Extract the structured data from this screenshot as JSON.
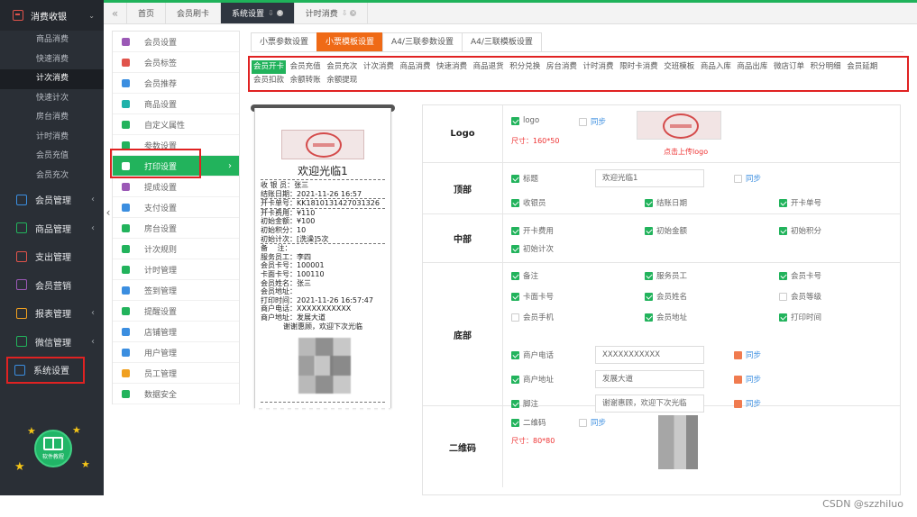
{
  "sidebar": {
    "top": {
      "label": "消费收银"
    },
    "sub_items": [
      "商品消费",
      "快速消费",
      "计次消费",
      "快速计次",
      "房台消费",
      "计时消费",
      "会员充值",
      "会员充次"
    ],
    "active_sub": 2,
    "groups": [
      {
        "label": "会员管理",
        "icon": "users-icon",
        "color": "#3b8ee0",
        "arrow": "‹"
      },
      {
        "label": "商品管理",
        "icon": "box-icon",
        "color": "#22b35c",
        "arrow": "‹"
      },
      {
        "label": "支出管理",
        "icon": "expense-icon",
        "color": "#e0534b",
        "arrow": ""
      },
      {
        "label": "会员营销",
        "icon": "gift-icon",
        "color": "#9b59b6",
        "arrow": ""
      },
      {
        "label": "报表管理",
        "icon": "chart-icon",
        "color": "#f0a020",
        "arrow": "‹"
      },
      {
        "label": "微信管理",
        "icon": "wechat-icon",
        "color": "#22b35c",
        "arrow": "‹"
      },
      {
        "label": "系统设置",
        "icon": "gear-icon",
        "color": "#3b8ee0",
        "arrow": ""
      }
    ],
    "help_label": "软件教程"
  },
  "tabs": [
    {
      "label": "首页",
      "active": false,
      "closable": false
    },
    {
      "label": "会员刷卡",
      "active": false,
      "closable": false
    },
    {
      "label": "系统设置",
      "active": true,
      "closable": true
    },
    {
      "label": "计时消费",
      "active": false,
      "closable": true
    }
  ],
  "settings_menu": [
    {
      "label": "会员设置",
      "color": "#9b59b6"
    },
    {
      "label": "会员标签",
      "color": "#e0534b"
    },
    {
      "label": "会员推荐",
      "color": "#3b8ee0"
    },
    {
      "label": "商品设置",
      "color": "#20b2aa"
    },
    {
      "label": "自定义属性",
      "color": "#22b35c"
    },
    {
      "label": "参数设置",
      "color": "#22b35c"
    },
    {
      "label": "打印设置",
      "color": "#ffffff",
      "active": true
    },
    {
      "label": "提成设置",
      "color": "#9b59b6"
    },
    {
      "label": "支付设置",
      "color": "#3b8ee0"
    },
    {
      "label": "房台设置",
      "color": "#22b35c"
    },
    {
      "label": "计次规则",
      "color": "#22b35c"
    },
    {
      "label": "计时管理",
      "color": "#22b35c"
    },
    {
      "label": "签到管理",
      "color": "#3b8ee0"
    },
    {
      "label": "提醒设置",
      "color": "#22b35c"
    },
    {
      "label": "店铺管理",
      "color": "#3b8ee0"
    },
    {
      "label": "用户管理",
      "color": "#3b8ee0"
    },
    {
      "label": "员工管理",
      "color": "#f0a020"
    },
    {
      "label": "数据安全",
      "color": "#22b35c"
    }
  ],
  "template_tabs": [
    {
      "label": "小票参数设置",
      "active": false
    },
    {
      "label": "小票模板设置",
      "active": true
    },
    {
      "label": "A4/三联参数设置",
      "active": false
    },
    {
      "label": "A4/三联模板设置",
      "active": false
    }
  ],
  "print_types": [
    "会员开卡",
    "会员充值",
    "会员充次",
    "计次消费",
    "商品消费",
    "快速消费",
    "商品退货",
    "积分兑换",
    "房台消费",
    "计时消费",
    "限时卡消费",
    "交班模板",
    "商品入库",
    "商品出库",
    "微店订单",
    "积分明细",
    "会员延期",
    "会员扣款",
    "余额转账",
    "余额提现"
  ],
  "active_type": 0,
  "receipt": {
    "title": "欢迎光临1",
    "lines_top": [
      "收 银 员：张三",
      "结账日期：2021-11-26 16:57"
    ],
    "lines_card": [
      "开卡单号：KK1810131427031326"
    ],
    "lines_mid": [
      "开卡费用：¥110",
      "初始金额：¥100",
      "初始积分：10"
    ],
    "lines_count": [
      "初始计次：[洗澡]5次"
    ],
    "lines_bottom": [
      "备　 注：",
      "服务员工：李四",
      "会员卡号：100001",
      "卡面卡号：100110",
      "会员姓名：张三",
      "会员地址：",
      "打印时间：2021-11-26 16:57:47",
      "商户电话：XXXXXXXXXXX",
      "商户地址：发展大道"
    ],
    "footer": "谢谢惠顾，欢迎下次光临"
  },
  "config": {
    "logo": {
      "label": "Logo",
      "checkbox": "logo",
      "sync": "同步",
      "size_hint": "尺寸：160*50",
      "upload_link": "点击上传logo"
    },
    "top": {
      "label": "顶部",
      "title_cb": "标题",
      "title_value": "欢迎光临1",
      "sync": "同步",
      "cashier": "收银员",
      "checkout_date": "结账日期",
      "card_no": "开卡单号"
    },
    "middle": {
      "label": "中部",
      "items": [
        "开卡费用",
        "初始金额",
        "初始积分",
        "初始计次"
      ]
    },
    "bottom": {
      "label": "底部",
      "items": [
        {
          "label": "备注",
          "on": true
        },
        {
          "label": "服务员工",
          "on": true
        },
        {
          "label": "会员卡号",
          "on": true
        },
        {
          "label": "卡面卡号",
          "on": true
        },
        {
          "label": "会员姓名",
          "on": true
        },
        {
          "label": "会员等级",
          "on": false
        },
        {
          "label": "会员手机",
          "on": false
        },
        {
          "label": "会员地址",
          "on": true
        },
        {
          "label": "打印时间",
          "on": true
        }
      ],
      "phone_label": "商户电话",
      "phone_value": "XXXXXXXXXXX",
      "address_label": "商户地址",
      "address_value": "发展大道",
      "footer_label": "脚注",
      "footer_value": "谢谢惠顾，欢迎下次光临",
      "sync": "同步"
    },
    "qr": {
      "label": "二维码",
      "checkbox": "二维码",
      "sync": "同步",
      "size_hint": "尺寸：80*80"
    }
  },
  "watermark": "CSDN @szzhiluo"
}
